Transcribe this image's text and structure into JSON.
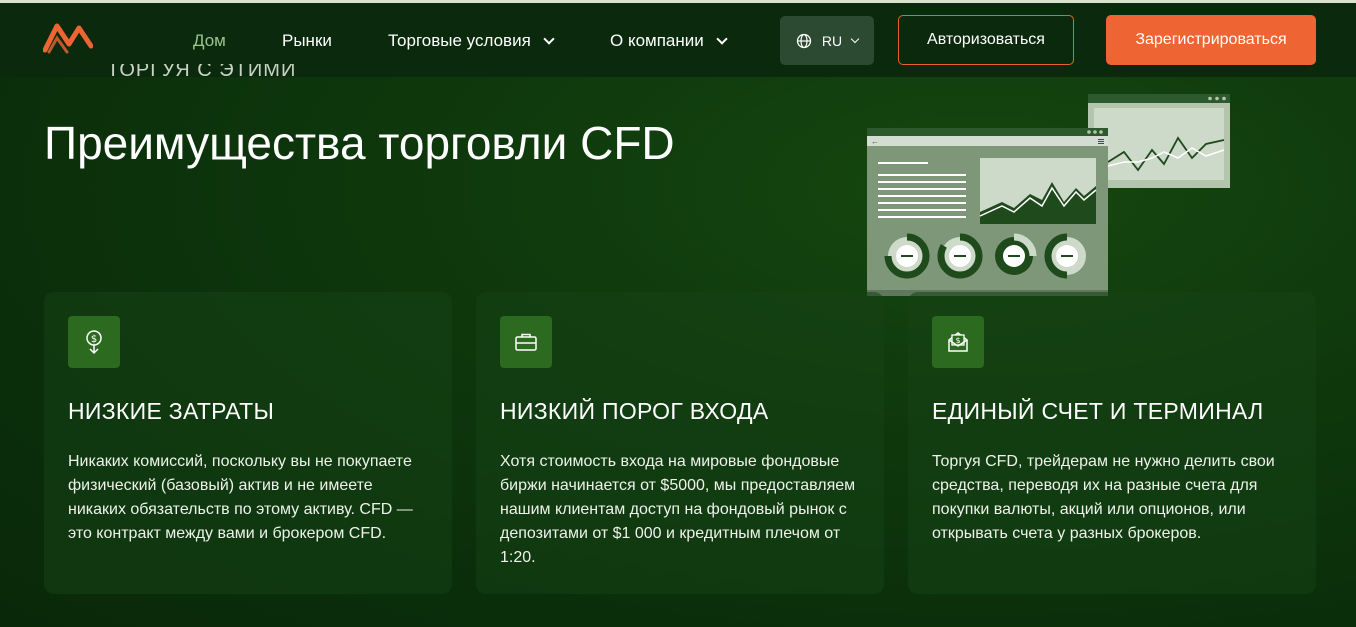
{
  "header": {
    "logo": "logo-icon",
    "nav": [
      {
        "label": "Дом",
        "active": true
      },
      {
        "label": "Рынки"
      },
      {
        "label": "Торговые условия",
        "dropdown": true
      },
      {
        "label": "О компании",
        "dropdown": true
      }
    ],
    "lang": {
      "label": "RU",
      "icon": "globe-icon"
    },
    "login_label": "Авторизоваться",
    "register_label": "Зарегистрироваться"
  },
  "colors": {
    "accent": "#ef6433",
    "card_bg": "#163f16",
    "icon_bg": "#2c6a1f",
    "active_nav": "#9cc48d"
  },
  "hero": {
    "cut_text": "ТОРГУЯ С ЭТИМИ",
    "title": "Преимущества торговли CFD"
  },
  "cards": [
    {
      "icon": "dollar-down-icon",
      "title": "НИЗКИЕ ЗАТРАТЫ",
      "text": "Никаких комиссий, поскольку вы не покупаете физический (базовый) актив и не имеете никаких обязательств по этому активу. CFD — это контракт между вами и брокером CFD."
    },
    {
      "icon": "briefcase-icon",
      "title": "НИЗКИЙ ПОРОГ ВХОДА",
      "text": "Хотя стоимость входа на мировые фондовые биржи начинается от $5000, мы предоставляем нашим клиентам доступ на фондовый рынок с депозитами от $1 000 и кредитным плечом от 1:20."
    },
    {
      "icon": "money-envelope-icon",
      "title": "ЕДИНЫЙ СЧЕТ И ТЕРМИНАЛ",
      "text": "Торгуя CFD, трейдерам не нужно делить свои средства, переводя их на разные счета для покупки валюты, акций или опционов, или открывать счета у разных брокеров."
    }
  ]
}
